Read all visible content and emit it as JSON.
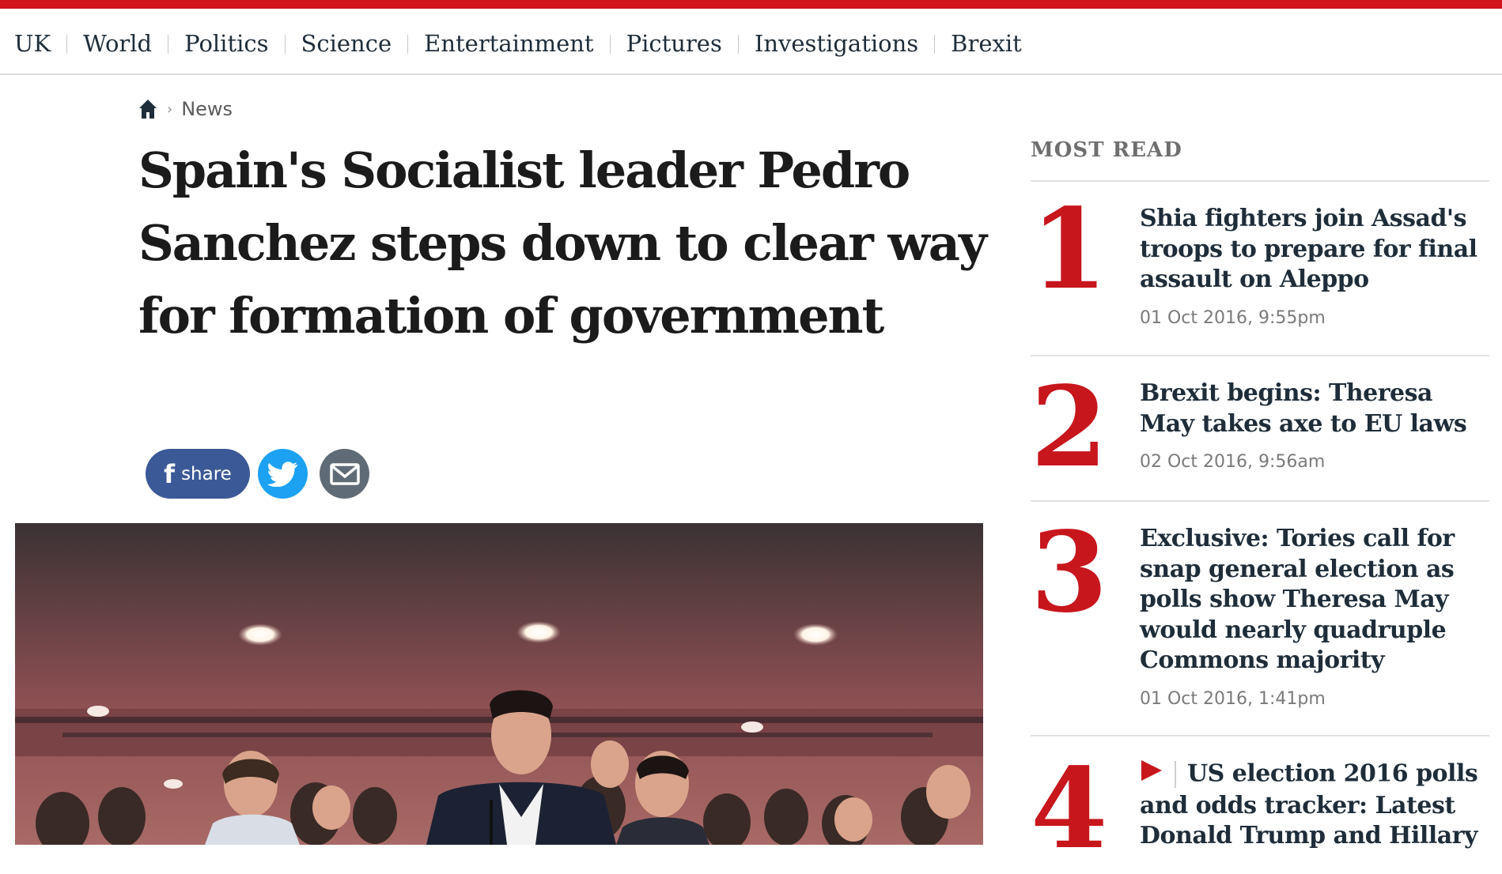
{
  "nav": {
    "items": [
      {
        "label": "UK"
      },
      {
        "label": "World"
      },
      {
        "label": "Politics"
      },
      {
        "label": "Science"
      },
      {
        "label": "Entertainment"
      },
      {
        "label": "Pictures"
      },
      {
        "label": "Investigations"
      },
      {
        "label": "Brexit"
      }
    ]
  },
  "breadcrumb": {
    "home_icon": "home-icon",
    "section": "News"
  },
  "article": {
    "headline": "Spain's Socialist leader Pedro Sanchez steps down to clear way for formation of government",
    "share": {
      "facebook_label": "share",
      "facebook_icon": "facebook-icon",
      "twitter_icon": "twitter-icon",
      "email_icon": "email-icon"
    }
  },
  "most_read": {
    "title": "MOST READ",
    "items": [
      {
        "rank": "1",
        "headline": "Shia fighters join Assad's troops to prepare for final assault on Aleppo",
        "date": "01 Oct 2016, 9:55pm"
      },
      {
        "rank": "2",
        "headline": "Brexit begins: Theresa May takes axe to EU laws",
        "date": "02 Oct 2016, 9:56am"
      },
      {
        "rank": "3",
        "headline": "Exclusive: Tories call for snap general election as polls show Theresa May would nearly quadruple Commons majority",
        "date": "01 Oct 2016, 1:41pm"
      },
      {
        "rank": "4",
        "headline": "US election 2016 polls and odds tracker: Latest Donald Trump and Hillary",
        "date": "",
        "video_icon": "play-icon"
      }
    ]
  },
  "colors": {
    "brand_red": "#d2141c",
    "rank_red": "#c7161c",
    "facebook_blue": "#3b5997",
    "twitter_blue": "#1da1f2",
    "email_grey": "#5f6b77"
  }
}
